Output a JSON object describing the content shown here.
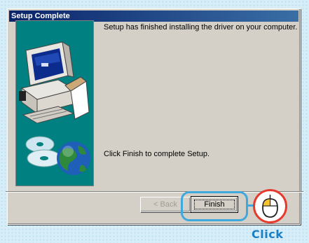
{
  "window": {
    "title": "Setup Complete"
  },
  "messages": {
    "finished": "Setup has finished installing the driver on your computer.",
    "instruction": "Click Finish to complete Setup."
  },
  "buttons": {
    "back_label": "< Back",
    "finish_label": "Finish"
  },
  "annotation": {
    "click_label": "Click"
  },
  "colors": {
    "title_bar": "#0a246a",
    "art_panel": "#008080",
    "highlight": "#3fa9dd",
    "mouse_ring": "#e63a2e",
    "click_text": "#1a7fc4"
  },
  "icons": {
    "art": "computer-with-cd-and-globe-illustration",
    "mouse": "mouse-icon"
  }
}
